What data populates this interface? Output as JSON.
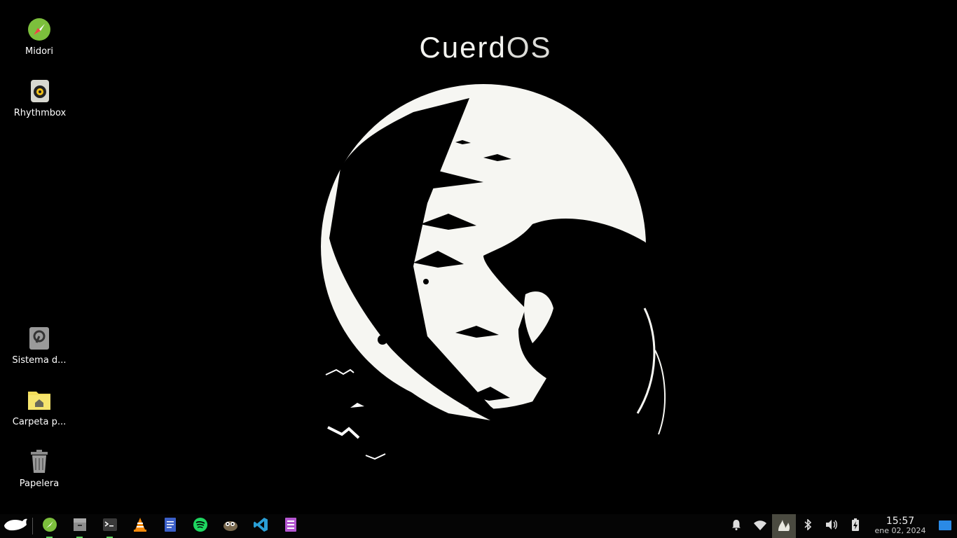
{
  "wallpaper": {
    "brand_part1": "Cuerd",
    "brand_part2": "OS"
  },
  "desktop_icons": [
    {
      "label": "Midori",
      "icon": "midori-browser-icon"
    },
    {
      "label": "Rhythmbox",
      "icon": "rhythmbox-icon"
    },
    {
      "label": "Sistema d...",
      "icon": "filesystem-drive-icon"
    },
    {
      "label": "Carpeta p...",
      "icon": "home-folder-icon"
    },
    {
      "label": "Papelera",
      "icon": "trash-icon"
    }
  ],
  "taskbar": {
    "start_icon": "whale-menu-icon",
    "apps": [
      {
        "name": "Midori",
        "icon": "midori-browser-icon",
        "running": true
      },
      {
        "name": "Files",
        "icon": "file-manager-icon",
        "running": true
      },
      {
        "name": "Terminal",
        "icon": "terminal-icon",
        "running": true
      },
      {
        "name": "VLC",
        "icon": "vlc-icon",
        "running": false
      },
      {
        "name": "Text editor",
        "icon": "text-editor-icon",
        "running": false
      },
      {
        "name": "Spotify",
        "icon": "spotify-icon",
        "running": false
      },
      {
        "name": "GIMP",
        "icon": "gimp-icon",
        "running": false
      },
      {
        "name": "VS Code",
        "icon": "vscode-icon",
        "running": false
      },
      {
        "name": "Notes",
        "icon": "notes-icon",
        "running": false
      }
    ],
    "tray": [
      "bell-icon",
      "wifi-icon",
      "flame-icon",
      "bluetooth-icon",
      "volume-icon",
      "battery-charging-icon"
    ],
    "clock": {
      "time": "15:57",
      "date": "ene 02, 2024"
    },
    "colors": {
      "bar": "#050505",
      "running_indicator": "#5fd35f",
      "active_tray": "#4a4a40"
    }
  }
}
